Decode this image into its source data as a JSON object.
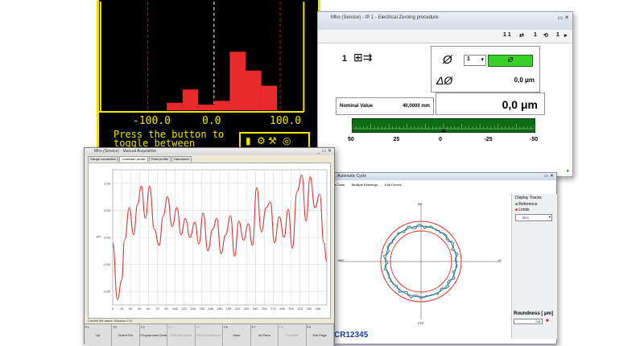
{
  "hist": {
    "scale_left": "-100.0",
    "scale_mid": "0.0",
    "scale_right": "100.0",
    "message": "Press the button to\ntoggle between\n         inch",
    "bars": [
      0.08,
      0.22,
      0.06,
      0.1,
      0.62,
      0.42,
      0.26
    ],
    "accent": "#f2e400",
    "bar_color": "#e82a2a"
  },
  "zero": {
    "title": "Mho (Service) - IP 1 - Electrical Zeroing procedure",
    "toolbar_page": "1 1",
    "toolbar_num": "1",
    "probe_num": "1",
    "selector_value": "1",
    "diameter_symbol": "Ø",
    "delta_symbol": "ΔØ",
    "delta_value": "0,0 μm",
    "nominal_label": "Nominal Value",
    "nominal_value": "40,0000 mm",
    "big_value": "0,0 μm",
    "gauge_labels": [
      "50",
      "25",
      "0",
      "-25",
      "-50"
    ],
    "gauge_color": "#0d6b14",
    "ok_color": "#39d12a"
  },
  "chart": {
    "title": "Mho (Service) - Manual Acquisition",
    "tabs": [
      "Gauge connection",
      "Cartesian profile",
      "Polar profile",
      "Harmonics"
    ],
    "active_tab": 1,
    "status": "Current file name: Session-F13",
    "fkeys": [
      {
        "fn": "F1",
        "label": "Up"
      },
      {
        "fn": "F2",
        "label": "Select File"
      },
      {
        "fn": "F3",
        "label": "Programmed Data"
      },
      {
        "fn": "F4",
        "label": "Part Sequence"
      },
      {
        "fn": "F5",
        "label": "Record Selection"
      },
      {
        "fn": "F6",
        "label": "Save"
      },
      {
        "fn": "F7",
        "label": "All Parts"
      },
      {
        "fn": "F8",
        "label": "Go Data"
      },
      {
        "fn": "F9",
        "label": "Exit Page"
      }
    ]
  },
  "chart_data": {
    "type": "line",
    "title": "",
    "xlabel": "",
    "ylabel": "μm",
    "yticks": [
      "1.00",
      "0.50",
      "0.00",
      "-0.50",
      "-1.00"
    ],
    "xticks": [
      "0",
      "15",
      "30",
      "45",
      "60",
      "75",
      "90",
      "105",
      "120",
      "135",
      "150",
      "165",
      "180",
      "195",
      "210",
      "225",
      "240",
      "255",
      "270",
      "285",
      "300",
      "315",
      "330",
      "345"
    ],
    "ylim": [
      -1.25,
      1.25
    ],
    "xlim": [
      0,
      360
    ],
    "series": [
      {
        "color": "#d63a3a",
        "x": [
          0,
          8,
          15,
          20,
          28,
          35,
          42,
          48,
          55,
          62,
          70,
          78,
          85,
          92,
          100,
          108,
          115,
          122,
          130,
          138,
          145,
          152,
          160,
          168,
          175,
          182,
          190,
          198,
          205,
          212,
          220,
          228,
          235,
          242,
          250,
          258,
          265,
          272,
          280,
          288,
          295,
          302,
          310,
          318,
          325,
          332,
          340,
          348,
          355,
          360
        ],
        "y": [
          -0.1,
          -1.15,
          -0.8,
          -0.05,
          0.55,
          0.05,
          0.62,
          0.95,
          0.35,
          0.95,
          0.15,
          -0.15,
          0.4,
          0.75,
          0.2,
          0.55,
          0.05,
          0.35,
          0.0,
          0.28,
          -0.12,
          0.45,
          -0.25,
          0.15,
          0.35,
          -0.3,
          0.05,
          0.4,
          -0.35,
          0.3,
          -0.05,
          0.25,
          -0.15,
          0.92,
          0.1,
          0.55,
          0.65,
          -0.1,
          0.38,
          0.0,
          0.52,
          -0.2,
          0.85,
          1.15,
          0.3,
          1.12,
          0.55,
          0.8,
          -0.1,
          -0.45
        ]
      }
    ]
  },
  "auto": {
    "title": "Automatic Cycle",
    "tabs": [
      "Part Data",
      "Multiple Readings",
      "Edit Curves"
    ],
    "angle_top": "90°",
    "angle_right": "0°",
    "angle_bottom": "270°",
    "angle_left": "180°",
    "display_traces_label": "Display Traces",
    "trace_reference": "Reference",
    "trace_limits": "Limits",
    "scale_value": "30.0",
    "roundness_label": "Roundness [ μm]",
    "roundness_value": "0,8",
    "serial": "CR12345"
  }
}
